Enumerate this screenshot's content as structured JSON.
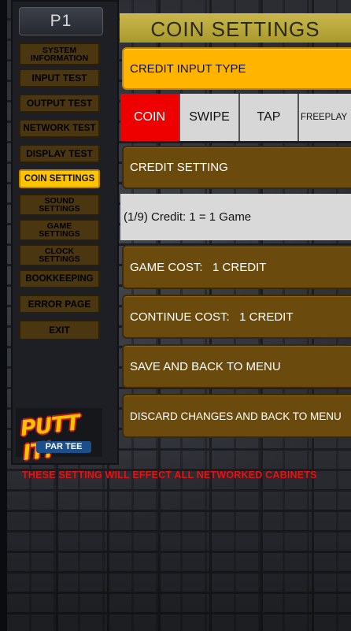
{
  "player_label": "P1",
  "sidebar": {
    "items": [
      {
        "label_line1": "SYSTEM",
        "label_line2": "INFORMATION"
      },
      {
        "label_line1": "INPUT TEST",
        "label_line2": ""
      },
      {
        "label_line1": "OUTPUT TEST",
        "label_line2": ""
      },
      {
        "label_line1": "NETWORK TEST",
        "label_line2": ""
      },
      {
        "label_line1": "DISPLAY TEST",
        "label_line2": ""
      },
      {
        "label_line1": "COIN SETTINGS",
        "label_line2": ""
      },
      {
        "label_line1": "SOUND",
        "label_line2": "SETTINGS"
      },
      {
        "label_line1": "GAME",
        "label_line2": "SETTINGS"
      },
      {
        "label_line1": "CLOCK",
        "label_line2": "SETTINGS"
      },
      {
        "label_line1": "BOOKKEEPING",
        "label_line2": ""
      },
      {
        "label_line1": "ERROR PAGE",
        "label_line2": ""
      },
      {
        "label_line1": "EXIT",
        "label_line2": ""
      }
    ],
    "active_index": 5
  },
  "logo": {
    "main": "PUTT IT!",
    "sub": "PAR TEE"
  },
  "header": {
    "title": "COIN SETTINGS"
  },
  "credit_input_type": {
    "label": "CREDIT INPUT TYPE",
    "options": [
      "COIN",
      "SWIPE",
      "TAP",
      "FREEPLAY"
    ],
    "selected": "COIN"
  },
  "credit_setting": {
    "label": "CREDIT SETTING",
    "value": "(1/9) Credit: 1 = 1 Game"
  },
  "game_cost": "GAME COST:   1 CREDIT",
  "continue_cost": "CONTINUE COST:   1 CREDIT",
  "save_button": "SAVE AND BACK TO MENU",
  "discard_button": "DISCARD CHANGES AND BACK TO MENU",
  "warning": "THESE SETTING WILL EFFECT ALL NETWORKED CABINETS",
  "colors": {
    "accent_yellow": "#ffb400",
    "active_nav": "#ffc300",
    "button_brown": "#6b4b0d",
    "selected_red": "#ee0000",
    "warning_red": "#e01616"
  }
}
